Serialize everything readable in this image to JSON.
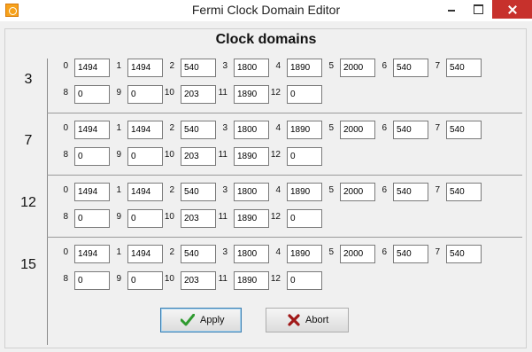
{
  "window": {
    "title": "Fermi Clock Domain Editor"
  },
  "header": {
    "title": "Clock domains"
  },
  "sections": [
    {
      "label": "3"
    },
    {
      "label": "7"
    },
    {
      "label": "12"
    },
    {
      "label": "15"
    }
  ],
  "fields": {
    "indices": [
      "0",
      "1",
      "2",
      "3",
      "4",
      "5",
      "6",
      "7",
      "8",
      "9",
      "10",
      "11",
      "12"
    ],
    "values": [
      [
        "1494",
        "1494",
        "540",
        "1800",
        "1890",
        "2000",
        "540",
        "540",
        "0",
        "0",
        "203",
        "1890",
        "0"
      ],
      [
        "1494",
        "1494",
        "540",
        "1800",
        "1890",
        "2000",
        "540",
        "540",
        "0",
        "0",
        "203",
        "1890",
        "0"
      ],
      [
        "1494",
        "1494",
        "540",
        "1800",
        "1890",
        "2000",
        "540",
        "540",
        "0",
        "0",
        "203",
        "1890",
        "0"
      ],
      [
        "1494",
        "1494",
        "540",
        "1800",
        "1890",
        "2000",
        "540",
        "540",
        "0",
        "0",
        "203",
        "1890",
        "0"
      ]
    ]
  },
  "buttons": {
    "apply": "Apply",
    "abort": "Abort"
  },
  "colors": {
    "apply_icon": "#2f9a2f",
    "abort_icon": "#a01818",
    "close_button": "#c7312c"
  },
  "icons": {
    "apply": "check-icon",
    "abort": "x-icon",
    "app": "app-icon"
  }
}
